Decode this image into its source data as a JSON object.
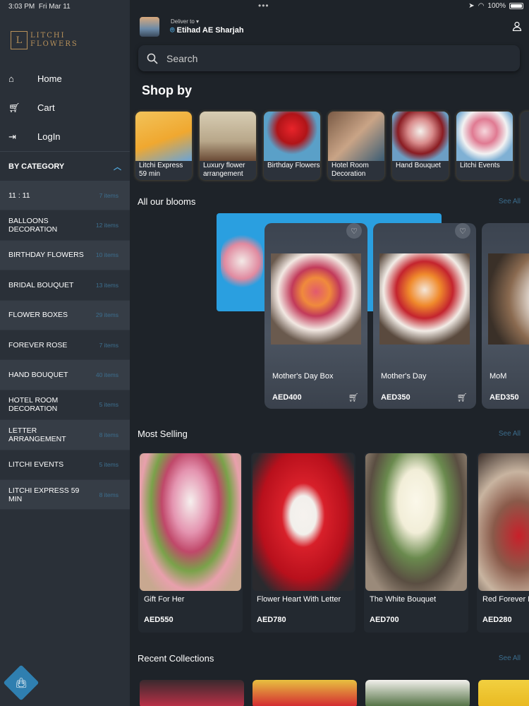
{
  "status": {
    "time": "3:03 PM",
    "date": "Fri Mar 11",
    "battery": "100%"
  },
  "brand": {
    "line1": "LITCHI",
    "line2": "FLOWERS",
    "mark": "L"
  },
  "nav": [
    {
      "label": "Home",
      "icon": "home-icon"
    },
    {
      "label": "Cart",
      "icon": "cart-icon"
    },
    {
      "label": "LogIn",
      "icon": "login-icon"
    }
  ],
  "category_header": "BY CATEGORY",
  "categories": [
    {
      "label": "11 : 11",
      "count": "7 items"
    },
    {
      "label": "BALLOONS DECORATION",
      "count": "12 items"
    },
    {
      "label": "BIRTHDAY FLOWERS",
      "count": "10 items"
    },
    {
      "label": "BRIDAL BOUQUET",
      "count": "13 items"
    },
    {
      "label": "FLOWER BOXES",
      "count": "29 items"
    },
    {
      "label": "FOREVER ROSE",
      "count": "7 items"
    },
    {
      "label": "HAND BOUQUET",
      "count": "40 items"
    },
    {
      "label": "HOTEL ROOM DECORATION",
      "count": "5 items"
    },
    {
      "label": "LETTER ARRANGEMENT",
      "count": "8 items"
    },
    {
      "label": "LITCHI EVENTS",
      "count": "5 items"
    },
    {
      "label": "LITCHI EXPRESS 59 MIN",
      "count": "8 items"
    }
  ],
  "header": {
    "deliver_to": "Deliver to",
    "location": "Etihad AE Sharjah"
  },
  "search": {
    "placeholder": "Search"
  },
  "shop_by": {
    "title": "Shop by",
    "items": [
      {
        "label": "Litchi Express 59 min"
      },
      {
        "label": "Luxury flower arrangement"
      },
      {
        "label": "Birthday Flowers"
      },
      {
        "label": "Hotel Room Decoration"
      },
      {
        "label": "Hand Bouquet"
      },
      {
        "label": "Litchi Events"
      }
    ]
  },
  "blooms": {
    "title": "All our blooms",
    "see_all": "See All",
    "items": [
      {
        "name": "Mother's Day Box",
        "price": "AED400"
      },
      {
        "name": "Mother's Day",
        "price": "AED350"
      },
      {
        "name": "MoM",
        "price": "AED350"
      }
    ]
  },
  "most_selling": {
    "title": "Most Selling",
    "see_all": "See All",
    "items": [
      {
        "name": "Gift For Her",
        "price": "AED550"
      },
      {
        "name": "Flower Heart With Letter",
        "price": "AED780"
      },
      {
        "name": "The White Bouquet",
        "price": "AED700"
      },
      {
        "name": "Red Forever Rose",
        "price": "AED280"
      }
    ]
  },
  "recent": {
    "title": "Recent Collections",
    "see_all": "See All"
  },
  "colors": {
    "accent": "#2f7fb0",
    "brand_gold": "#b8915a",
    "background": "#1e2329",
    "sidebar": "#2a3038"
  }
}
